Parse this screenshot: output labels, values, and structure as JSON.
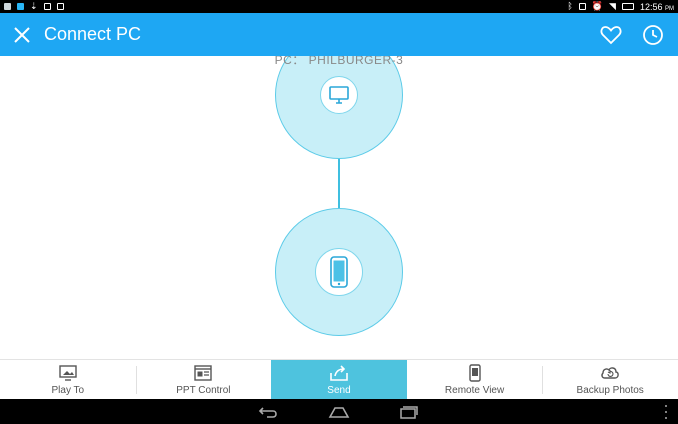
{
  "status_bar": {
    "time": "12:56",
    "ampm": "PM"
  },
  "app_bar": {
    "title": "Connect PC"
  },
  "connection": {
    "pc_label": "PC： PHILBURGER-3"
  },
  "tabs": [
    {
      "label": "Play To",
      "icon": "play-to-icon",
      "active": false
    },
    {
      "label": "PPT Control",
      "icon": "ppt-control-icon",
      "active": false
    },
    {
      "label": "Send",
      "icon": "send-icon",
      "active": true
    },
    {
      "label": "Remote View",
      "icon": "remote-view-icon",
      "active": false
    },
    {
      "label": "Backup Photos",
      "icon": "backup-photos-icon",
      "active": false
    }
  ],
  "colors": {
    "app_bar": "#1ea7f3",
    "active_tab": "#4ec3de",
    "node_fill": "#c8eff8",
    "node_stroke": "#5ccbe8"
  }
}
